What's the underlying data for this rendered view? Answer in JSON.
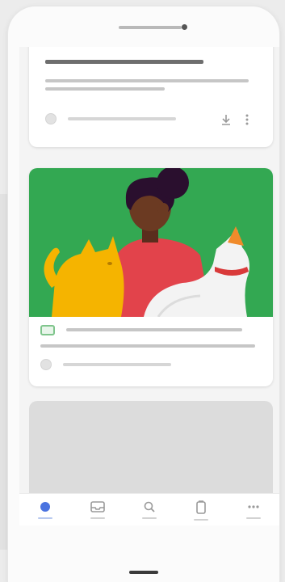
{
  "colors": {
    "illustration_background": "#33a852",
    "accent_blue": "#4a73e0",
    "placeholder_dark": "#6e6e6e",
    "placeholder_light": "#d6d6d6"
  },
  "feed": {
    "cards": [
      {
        "kind": "text-post",
        "icons": [
          "avatar-placeholder",
          "download-icon",
          "more-vertical-icon"
        ]
      },
      {
        "kind": "illustrated-post",
        "illustration": "woman-with-two-cats",
        "icons": [
          "image-tag-icon",
          "avatar-placeholder"
        ]
      },
      {
        "kind": "loading-placeholder"
      }
    ]
  },
  "bottom_nav": {
    "items": [
      {
        "icon": "home-dot-icon",
        "active": true
      },
      {
        "icon": "inbox-icon",
        "active": false
      },
      {
        "icon": "search-icon",
        "active": false
      },
      {
        "icon": "copy-icon",
        "active": false
      },
      {
        "icon": "more-horizontal-icon",
        "active": false
      }
    ]
  }
}
